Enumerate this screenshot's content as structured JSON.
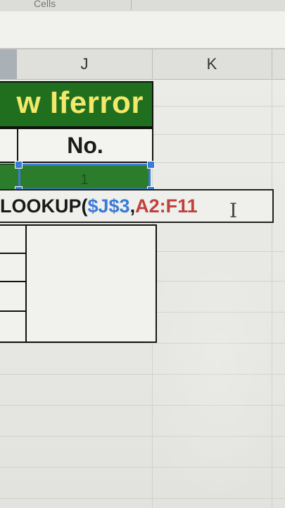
{
  "ribbon": {
    "group_label": "Cells"
  },
  "columns": {
    "j": "J",
    "k": "K"
  },
  "sheet": {
    "title_text": "w Iferror",
    "header_label": "No.",
    "selected_cell_value": "1"
  },
  "formula": {
    "part_function": "LOOKUP(",
    "part_ref_blue": "$J$3",
    "part_comma": ",",
    "part_range_red": "A2:F11"
  },
  "colors": {
    "title_fill": "#1f6f1f",
    "title_text": "#f2e86a",
    "selection_border": "#3b7bd8",
    "ref_blue": "#3a7bd9",
    "range_red": "#c0403c"
  },
  "icons": {
    "cursor": "i-beam-cursor-icon"
  }
}
